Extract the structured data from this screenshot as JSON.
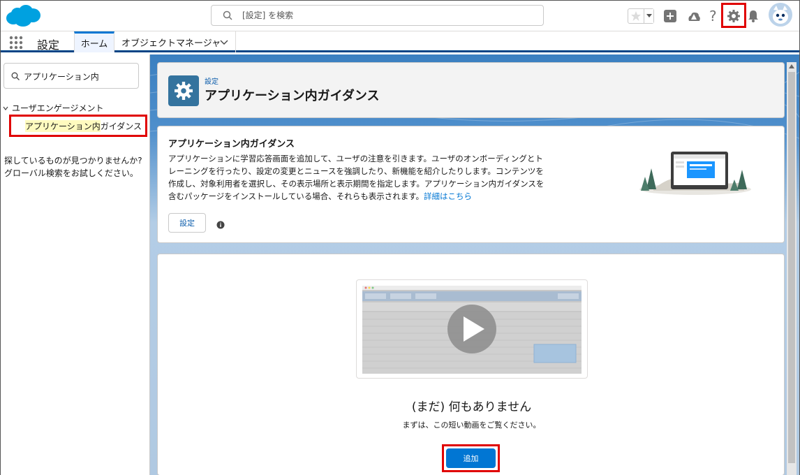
{
  "header": {
    "search_placeholder": "[設定] を検索"
  },
  "context_bar": {
    "app_name": "設定",
    "tabs": [
      {
        "label": "ホーム",
        "active": true
      },
      {
        "label": "オブジェクトマネージャ",
        "has_menu": true
      }
    ]
  },
  "sidebar": {
    "quick_find_value": "アプリケーション内",
    "tree_group": "ユーザエンゲージメント",
    "tree_item_highlight": "アプリケーション内",
    "tree_item_rest": "ガイダンス",
    "help_text": "探しているものが見つかりませんか? グローバル検索をお試しください。"
  },
  "page_header": {
    "breadcrumb": "設定",
    "title": "アプリケーション内ガイダンス",
    "icon": "gear-icon"
  },
  "info_card": {
    "title": "アプリケーション内ガイダンス",
    "description": "アプリケーションに学習応答画面を追加して、ユーザの注意を引きます。ユーザのオンボーディングとトレーニングを行ったり、設定の変更とニュースを強調したり、新機能を紹介したりします。コンテンツを作成し、対象利用者を選択し、その表示場所と表示期間を指定します。アプリケーション内ガイダンスを含むパッケージをインストールしている場合、それらも表示されます。",
    "link": "詳細はこちら",
    "settings_button": "設定"
  },
  "empty_state": {
    "title": "(まだ) 何もありません",
    "subtitle": "まずは、この短い動画をご覧ください。",
    "add_button": "追加"
  },
  "colors": {
    "brand_blue": "#0176d3",
    "highlight_red": "#e00000",
    "icon_bg": "#34739e"
  }
}
